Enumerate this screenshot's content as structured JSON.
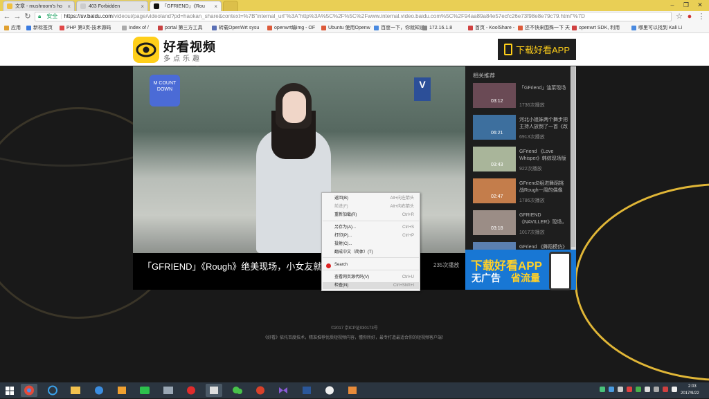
{
  "browser": {
    "tabs": [
      {
        "title": "文章 - mushroom's ho",
        "active": false
      },
      {
        "title": "403 Forbidden",
        "active": false
      },
      {
        "title": "「GFRIEND」《Rou",
        "active": true
      }
    ],
    "url_security": "安全",
    "url_host": "https://sv.baidu.com",
    "url_rest": "/videoui/page/videoland?pd=haokan_share&context=%7B\"internal_url\"%3A\"http%3A%5C%2F%5C%2Fwww.internal.video.baidu.com%5C%2F94aa89a84e57ecfc26e73f98e8e79c79.html\"%7D",
    "bookmarks": [
      "应用",
      "新标签页",
      "PHP 第3页-技术源码",
      "Index of /",
      "portal 第三方工具",
      "转载OpenWrt sysu",
      "openwrt编img - OF",
      "Ubuntu 使用Openw",
      "百度一下，你就知道",
      "172.16.1.8",
      "首页 - KoolShare -",
      "还不快来围殊一下 天",
      "openwrt SDK, 利用",
      "哪里可以找到 Kali Li"
    ]
  },
  "site": {
    "brand": "好看视频",
    "brand_sub": "多点乐趣",
    "download_label": "下载好看APP"
  },
  "video": {
    "title": "「GFRIEND」《Rough》绝美现场，小女友就",
    "views": "235次播放",
    "logo_text": "M COUNT DOWN",
    "channel_mark": "V"
  },
  "sidebar": {
    "title": "相关推荐",
    "items": [
      {
        "title": "「GFriend」油菜现场",
        "duration": "03:12",
        "views": "1736次播放",
        "color": "#6a4a55"
      },
      {
        "title": "河北小姐妹两个舞步把主持人放倒了一首《改",
        "duration": "06:21",
        "views": "6913次播放",
        "color": "#3d6f9e"
      },
      {
        "title": "GFriend 《Love Whisper》韩综现场版",
        "duration": "03:43",
        "views": "922次播放",
        "color": "#a9b59a"
      },
      {
        "title": "GFriend2组进舞蹈挑战Rough一周的偶像",
        "duration": "02:47",
        "views": "1786次播放",
        "color": "#c47d4b"
      },
      {
        "title": "GFRIEND 《NAVILLER》现场，一看就是成很",
        "duration": "03:18",
        "views": "1017次播放",
        "color": "#9b8d86"
      },
      {
        "title": "GFriend 《舞蹈模仿》",
        "duration": "",
        "views": "",
        "color": "#5b7fb0"
      }
    ]
  },
  "ad": {
    "line1": "下载好看APP",
    "line2a": "无广告",
    "line2b": "省流量"
  },
  "context_menu": [
    {
      "label": "返回(B)",
      "shortcut": "Alt+向左箭头",
      "disabled": false
    },
    {
      "label": "前进(F)",
      "shortcut": "Alt+向右箭头",
      "disabled": true
    },
    {
      "label": "重新加载(R)",
      "shortcut": "Ctrl+R",
      "disabled": false
    },
    {
      "label": "另存为(A)...",
      "shortcut": "Ctrl+S",
      "disabled": false
    },
    {
      "label": "打印(P)...",
      "shortcut": "Ctrl+P",
      "disabled": false
    },
    {
      "label": "投射(C)...",
      "shortcut": "",
      "disabled": false
    },
    {
      "label": "翻成中文（简体）(T)",
      "shortcut": "",
      "disabled": false
    },
    {
      "label": "Search",
      "shortcut": "",
      "disabled": false
    },
    {
      "label": "查看网页源代码(V)",
      "shortcut": "Ctrl+U",
      "disabled": false
    },
    {
      "label": "检查(N)",
      "shortcut": "Ctrl+Shift+I",
      "disabled": false
    }
  ],
  "footer": {
    "line1": "©2017    京ICP证030173号",
    "line2": "《好看》依托百度技术，精准推荐优质短视频内容，懂你所好，最专打造最适合你的短视频客户端！"
  },
  "taskbar": {
    "time": "2:03",
    "date": "2017/9/22"
  }
}
